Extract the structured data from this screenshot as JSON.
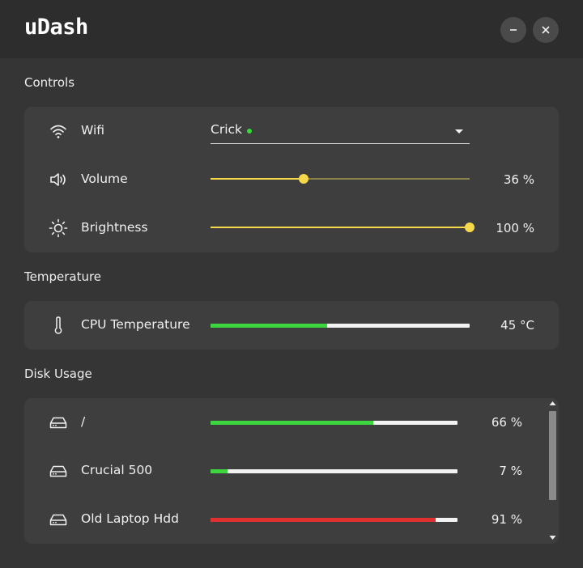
{
  "app": {
    "title": "uDash"
  },
  "window_controls": {
    "minimize_icon": "minus-icon",
    "close_icon": "close-icon"
  },
  "sections": {
    "controls": "Controls",
    "temperature": "Temperature",
    "disk_usage": "Disk Usage"
  },
  "controls": {
    "wifi": {
      "label": "Wifi",
      "icon": "wifi-icon",
      "selected": "Crick",
      "status_color": "#33dd33"
    },
    "volume": {
      "label": "Volume",
      "icon": "speaker-icon",
      "level": 0.36,
      "value": "36 %"
    },
    "brightness": {
      "label": "Brightness",
      "icon": "sun-icon",
      "level": 1.0,
      "value": "100 %"
    }
  },
  "temperature": {
    "cpu": {
      "label": "CPU Temperature",
      "icon": "thermometer-icon",
      "level": 0.45,
      "value": "45 °C",
      "color": "#3ed63e"
    }
  },
  "disks": [
    {
      "label": "/",
      "icon": "hard-drive-icon",
      "level": 0.66,
      "value": "66 %",
      "color": "#3ed63e"
    },
    {
      "label": "Crucial 500",
      "icon": "hard-drive-icon",
      "level": 0.07,
      "value": "7 %",
      "color": "#3ed63e"
    },
    {
      "label": "Old Laptop Hdd",
      "icon": "hard-drive-icon",
      "level": 0.91,
      "value": "91 %",
      "color": "#e03030"
    }
  ],
  "colors": {
    "accent": "#f6d94a",
    "track": "#a89a5a",
    "bar_bg": "#f2f2f2"
  }
}
